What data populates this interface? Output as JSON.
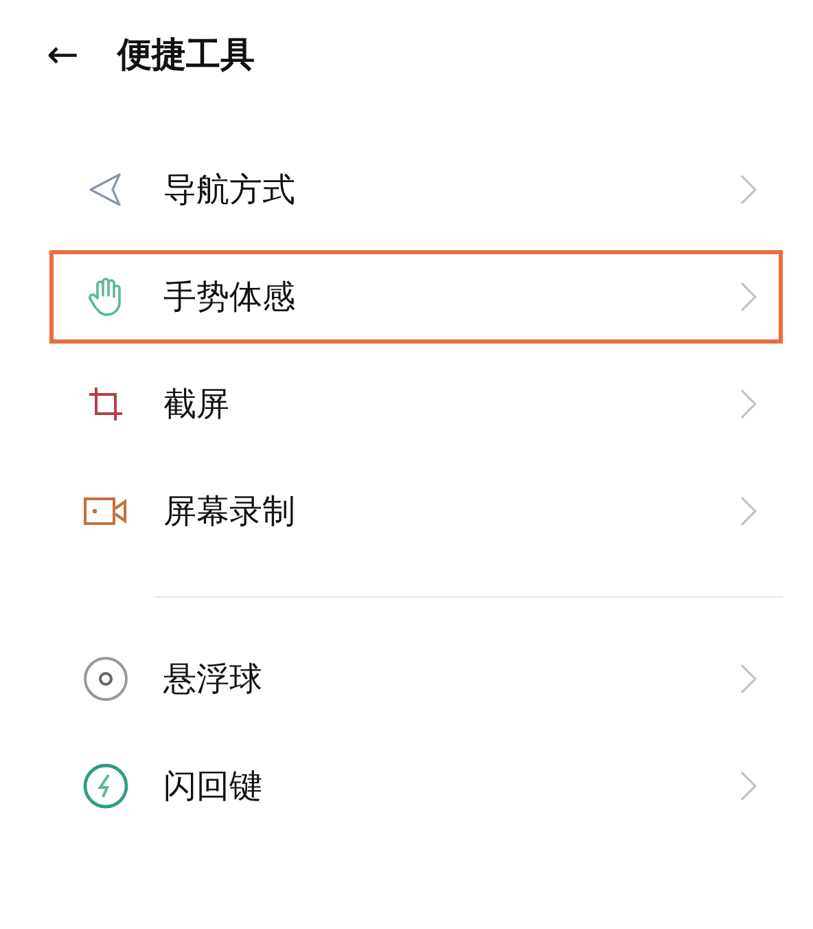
{
  "header": {
    "back": "←",
    "title": "便捷工具"
  },
  "sections": [
    {
      "items": [
        {
          "kind": "navigation",
          "label": "导航方式",
          "highlighted": false
        },
        {
          "kind": "gesture",
          "label": "手势体感",
          "highlighted": true
        },
        {
          "kind": "screenshot",
          "label": "截屏",
          "highlighted": false
        },
        {
          "kind": "record",
          "label": "屏幕录制",
          "highlighted": false
        }
      ]
    },
    {
      "items": [
        {
          "kind": "float",
          "label": "悬浮球",
          "highlighted": false
        },
        {
          "kind": "flash",
          "label": "闪回键",
          "highlighted": false
        }
      ]
    }
  ]
}
